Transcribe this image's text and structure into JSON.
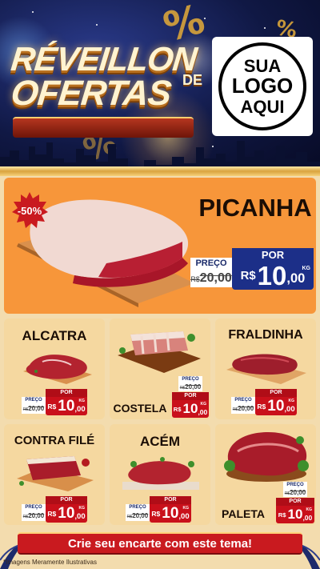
{
  "header": {
    "title_line1": "RÉVEILLON",
    "title_de": "DE",
    "title_line2": "OFERTAS",
    "logo_line1": "SUA",
    "logo_line2": "LOGO",
    "logo_line3": "AQUI",
    "decor_percent": "%"
  },
  "featured": {
    "name": "PICANHA",
    "discount": "-50%",
    "preco_label": "PREÇO",
    "old_rs": "R$",
    "old_price": "20,00",
    "por_label": "POR",
    "price_rs": "R$",
    "price_int": "10",
    "price_cents": ",00",
    "unit": "KG"
  },
  "products": [
    {
      "name": "ALCATRA",
      "preco_label": "PREÇO",
      "old_rs": "R$",
      "old_price": "20,00",
      "por_label": "POR",
      "price_rs": "R$",
      "price_int": "10",
      "price_cents": ",00",
      "unit": "KG"
    },
    {
      "name": "COSTELA",
      "preco_label": "PREÇO",
      "old_rs": "R$",
      "old_price": "20,00",
      "por_label": "POR",
      "price_rs": "R$",
      "price_int": "10",
      "price_cents": ",00",
      "unit": "KG"
    },
    {
      "name": "FRALDINHA",
      "preco_label": "PREÇO",
      "old_rs": "R$",
      "old_price": "20,00",
      "por_label": "POR",
      "price_rs": "R$",
      "price_int": "10",
      "price_cents": ",00",
      "unit": "KG"
    },
    {
      "name": "CONTRA FILÉ",
      "preco_label": "PREÇO",
      "old_rs": "R$",
      "old_price": "20,00",
      "por_label": "POR",
      "price_rs": "R$",
      "price_int": "10",
      "price_cents": ",00",
      "unit": "KG"
    },
    {
      "name": "ACÉM",
      "preco_label": "PREÇO",
      "old_rs": "R$",
      "old_price": "20,00",
      "por_label": "POR",
      "price_rs": "R$",
      "price_int": "10",
      "price_cents": ",00",
      "unit": "KG"
    },
    {
      "name": "PALETA",
      "preco_label": "PREÇO",
      "old_rs": "R$",
      "old_price": "20,00",
      "por_label": "POR",
      "price_rs": "R$",
      "price_int": "10",
      "price_cents": ",00",
      "unit": "KG"
    }
  ],
  "footer": {
    "cta": "Crie seu encarte com este tema!",
    "footnote": "*Imagens Meramente Ilustrativas"
  },
  "colors": {
    "header_bg": "#101844",
    "gold": "#d9a33e",
    "featured_bg": "#f7963a",
    "card_bg": "#f5d8a0",
    "page_bg": "#f3dcae",
    "price_red": "#c9101b",
    "price_blue": "#1c2f88"
  }
}
